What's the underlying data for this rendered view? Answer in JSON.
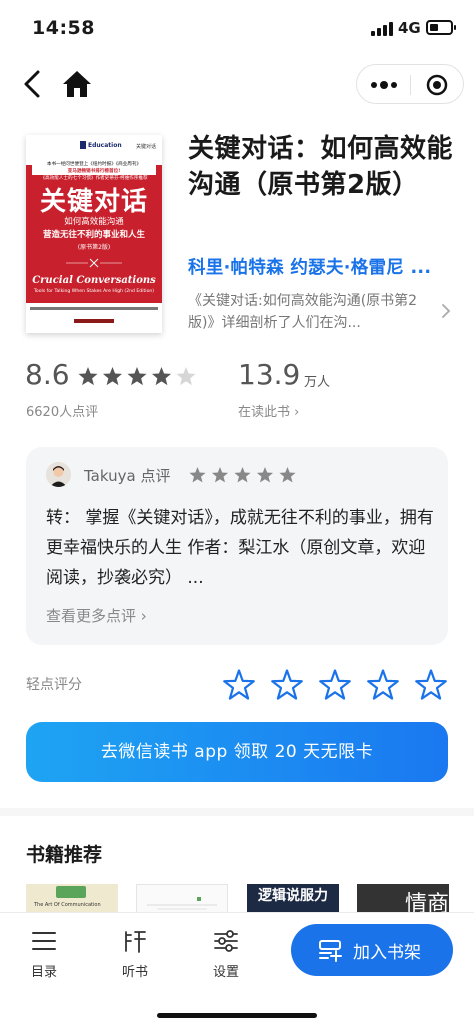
{
  "status": {
    "time": "14:58",
    "network": "4G"
  },
  "nav": {},
  "book": {
    "cover": {
      "brand": "Education",
      "tag": "关键对话",
      "blurb1": "本书一经问世便登上《纽约时报》《商业周刊》",
      "blurb2": "亚马逊畅销书排行榜首位!",
      "blurb3": "《高效能人士的七个习惯》作者史蒂芬·柯维作序推荐",
      "title": "关键对话",
      "sub1": "如何高效能沟通",
      "sub2": "营造无往不利的事业和人生",
      "edition": "(原书第2版)",
      "en_title": "Crucial Conversations",
      "en_sub": "Tools for Talking When Stakes Are High (2nd Edition)"
    },
    "title": "关键对话：如何高效能沟通（原书第2版）",
    "author": "科里·帕特森 约瑟夫·格雷尼 ...",
    "description": "《关键对话:如何高效能沟通(原书第2版)》详细剖析了人们在沟..."
  },
  "rating": {
    "score": "8.6",
    "stars_filled": 4,
    "count_text": "6620人点评",
    "readers_num": "13.9",
    "readers_unit": "万人",
    "readers_link": "在读此书 ›"
  },
  "review": {
    "reviewer": "Takuya 点评",
    "stars": 5,
    "text": "转： 掌握《关键对话》，成就无往不利的事业，拥有更幸福快乐的人生 作者：梨江水（原创文章，欢迎阅读，抄袭必究） ...",
    "more": "查看更多点评 ›"
  },
  "quick_rate": {
    "label": "轻点评分",
    "count": 5
  },
  "cta": {
    "label": "去微信读书 app 领取 20 天无限卡"
  },
  "recommend": {
    "title": "书籍推荐",
    "books": [
      {
        "label": "The Art Of Communication"
      },
      {
        "label": ""
      },
      {
        "label": "逻辑说服力"
      },
      {
        "label": "情商"
      }
    ]
  },
  "bottom": {
    "tabs": [
      {
        "label": "目录",
        "icon": "list-icon"
      },
      {
        "label": "听书",
        "icon": "listen-icon"
      },
      {
        "label": "设置",
        "icon": "settings-icon"
      }
    ],
    "add_shelf": "加入书架"
  },
  "colors": {
    "accent": "#1a73e8",
    "cover_red": "#c8202c"
  }
}
